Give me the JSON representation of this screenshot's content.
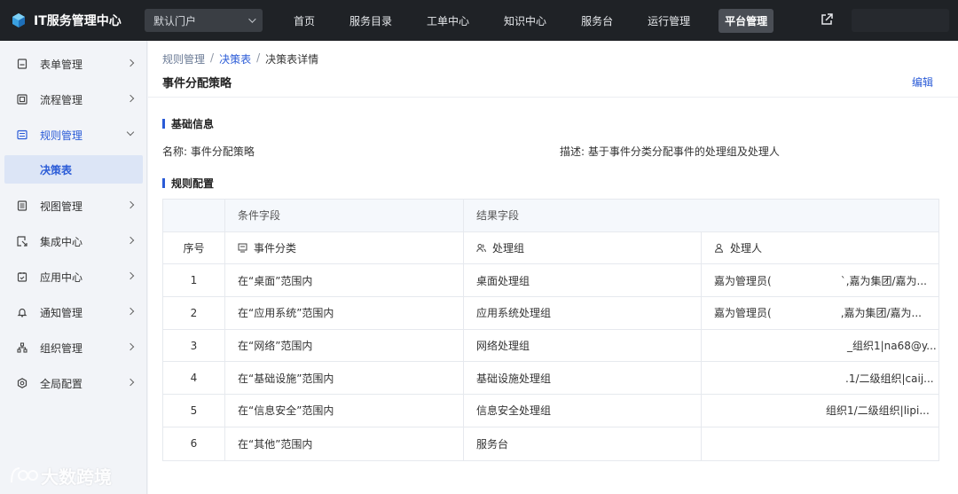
{
  "app": {
    "title": "IT服务管理中心"
  },
  "portal_select": {
    "value": "默认门户"
  },
  "nav": {
    "items": [
      {
        "label": "首页"
      },
      {
        "label": "服务目录"
      },
      {
        "label": "工单中心"
      },
      {
        "label": "知识中心"
      },
      {
        "label": "服务台"
      },
      {
        "label": "运行管理"
      },
      {
        "label": "平台管理",
        "active": true
      }
    ]
  },
  "sidebar": {
    "items": [
      {
        "label": "表单管理",
        "icon": "form-icon"
      },
      {
        "label": "流程管理",
        "icon": "flow-icon"
      },
      {
        "label": "规则管理",
        "icon": "rules-icon",
        "open": true
      },
      {
        "label": "视图管理",
        "icon": "view-icon"
      },
      {
        "label": "集成中心",
        "icon": "integration-icon"
      },
      {
        "label": "应用中心",
        "icon": "app-icon"
      },
      {
        "label": "通知管理",
        "icon": "bell-icon"
      },
      {
        "label": "组织管理",
        "icon": "org-icon"
      },
      {
        "label": "全局配置",
        "icon": "settings-icon"
      }
    ],
    "sub_active": "决策表"
  },
  "breadcrumb": {
    "items": [
      "规则管理",
      "决策表",
      "决策表详情"
    ],
    "sep": "/"
  },
  "page": {
    "title": "事件分配策略",
    "edit": "编辑"
  },
  "basic": {
    "heading": "基础信息",
    "name_label": "名称:",
    "name_value": "事件分配策略",
    "desc_label": "描述:",
    "desc_value": "基于事件分类分配事件的处理组及处理人"
  },
  "rules": {
    "heading": "规则配置",
    "group_headers": {
      "condition": "条件字段",
      "result": "结果字段"
    },
    "columns": {
      "index": "序号",
      "category": "事件分类",
      "group": "处理组",
      "person": "处理人"
    },
    "rows": [
      {
        "index": "1",
        "condition": "在“桌面”范围内",
        "group": "桌面处理组",
        "person_a": "嘉为管理员(",
        "person_b": "`,嘉为集团/嘉为..."
      },
      {
        "index": "2",
        "condition": "在“应用系统”范围内",
        "group": "应用系统处理组",
        "person_a": "嘉为管理员(",
        "person_b": ",嘉为集团/嘉为..."
      },
      {
        "index": "3",
        "condition": "在“网络”范围内",
        "group": "网络处理组",
        "person_a": "",
        "person_b": "_组织1|na68@y..."
      },
      {
        "index": "4",
        "condition": "在“基础设施”范围内",
        "group": "基础设施处理组",
        "person_a": "",
        "person_b": ".1/二级组织|caij..."
      },
      {
        "index": "5",
        "condition": "在“信息安全”范围内",
        "group": "信息安全处理组",
        "person_a": "",
        "person_b": "组织1/二级组织|lipi..."
      },
      {
        "index": "6",
        "condition": "在“其他”范围内",
        "group": "服务台",
        "person_a": "",
        "person_b": ""
      }
    ]
  },
  "watermark": {
    "text": "大数跨境"
  },
  "colors": {
    "accent": "#2a5bd7",
    "topbar": "#1f2226"
  }
}
